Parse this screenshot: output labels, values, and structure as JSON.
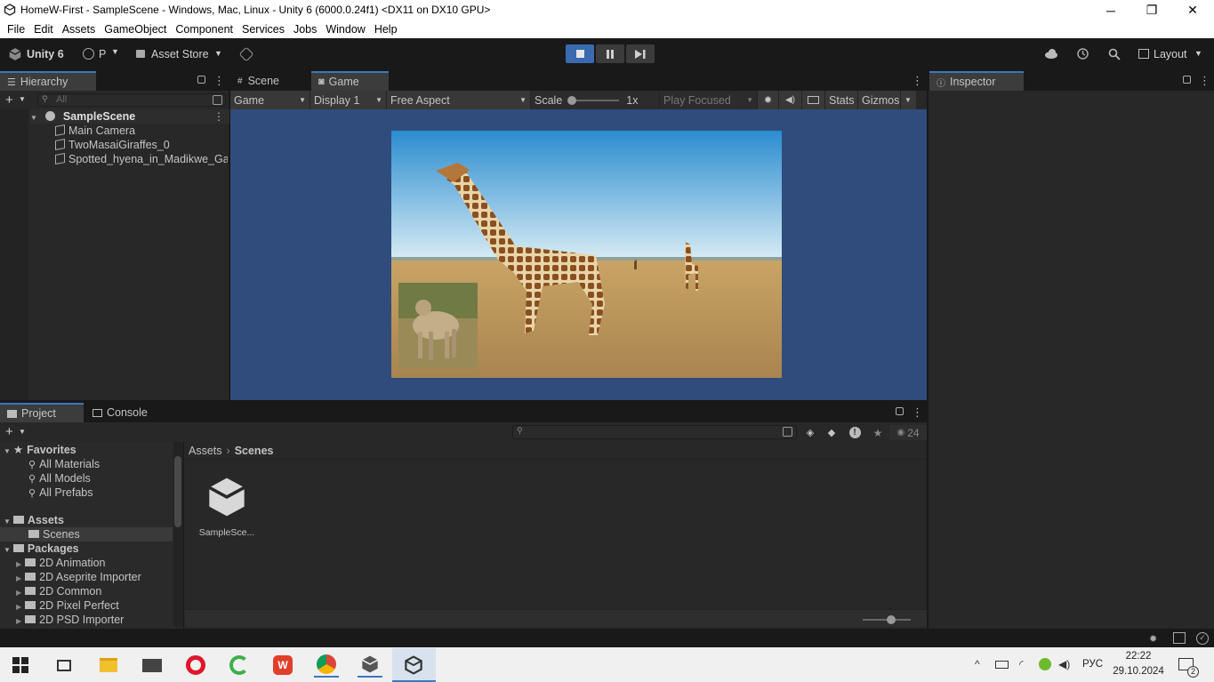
{
  "window": {
    "title": "HomeW-First - SampleScene - Windows, Mac, Linux - Unity 6 (6000.0.24f1) <DX11 on DX10 GPU>",
    "minimize": "─",
    "restore": "❐",
    "close": "✕"
  },
  "menu": [
    "File",
    "Edit",
    "Assets",
    "GameObject",
    "Component",
    "Services",
    "Jobs",
    "Window",
    "Help"
  ],
  "toolbar": {
    "unity_label": "Unity 6",
    "account_label": "P",
    "asset_store_label": "Asset Store",
    "layout_label": "Layout"
  },
  "hierarchy": {
    "tab": "Hierarchy",
    "search_placeholder": "All",
    "scene": "SampleScene",
    "items": [
      "Main Camera",
      "TwoMasaiGiraffes_0",
      "Spotted_hyena_in_Madikwe_Ga"
    ]
  },
  "view_tabs": {
    "scene": "Scene",
    "game": "Game"
  },
  "game_toolbar": {
    "mode": "Game",
    "display": "Display 1",
    "aspect": "Free Aspect",
    "scale_label": "Scale",
    "scale_value": "1x",
    "play_focused": "Play Focused",
    "stats": "Stats",
    "gizmos": "Gizmos"
  },
  "inspector": {
    "tab": "Inspector"
  },
  "bottom_tabs": {
    "project": "Project",
    "console": "Console"
  },
  "project": {
    "count": "24",
    "breadcrumb": [
      "Assets",
      "Scenes"
    ],
    "favorites": {
      "label": "Favorites",
      "items": [
        "All Materials",
        "All Models",
        "All Prefabs"
      ]
    },
    "assets": {
      "label": "Assets",
      "items": [
        "Scenes"
      ]
    },
    "packages": {
      "label": "Packages",
      "items": [
        "2D Animation",
        "2D Aseprite Importer",
        "2D Common",
        "2D Pixel Perfect",
        "2D PSD Importer"
      ]
    },
    "grid_items": [
      "SampleSce..."
    ]
  },
  "taskbar": {
    "lang": "РУС",
    "time": "22:22",
    "date": "29.10.2024",
    "notif_count": "2"
  },
  "colors": {
    "game_bg": "#2f4c7c",
    "accent": "#3a79bb",
    "sky_top": "#2a8ccf",
    "savanna": "#c9a465"
  }
}
